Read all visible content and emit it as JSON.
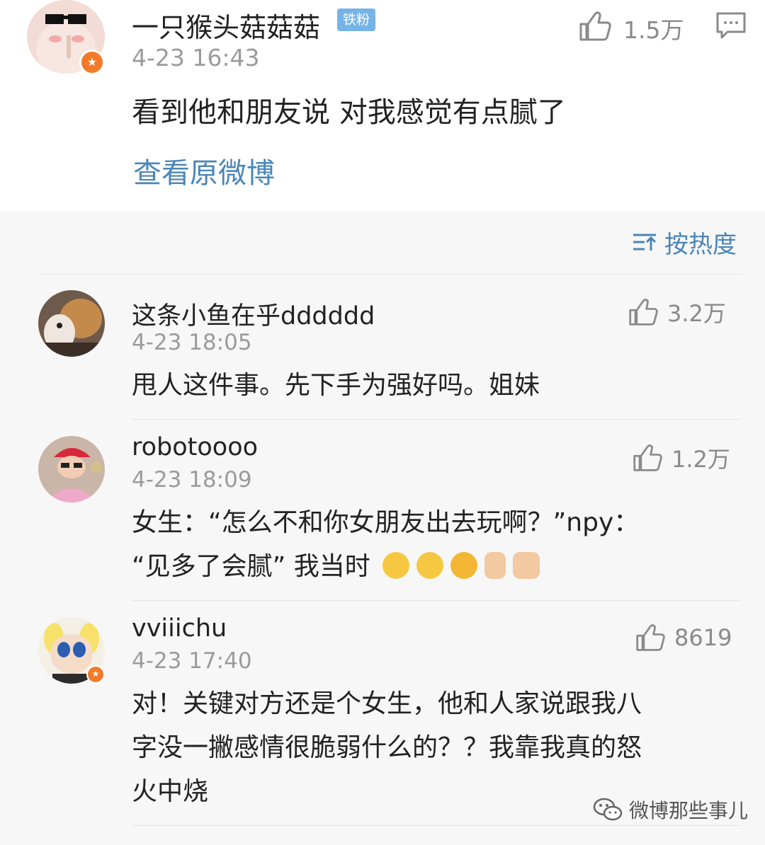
{
  "post": {
    "username": "一只猴头菇菇菇",
    "fan_badge": "铁粉",
    "time": "4-23 16:43",
    "likes": "1.5万",
    "text": "看到他和朋友说 对我感觉有点腻了",
    "view_original": "查看原微博",
    "avatar_icon": "avatar-sunglasses-cat",
    "verified_icon": "star-badge-icon"
  },
  "sort": {
    "label": "按热度",
    "icon": "sort-lines-icon"
  },
  "comments": [
    {
      "username": "这条小鱼在乎dddddd",
      "time": "4-23 18:05",
      "likes": "3.2万",
      "text": "甩人这件事。先下手为强好吗。姐妹",
      "avatar_icon": "avatar-dog"
    },
    {
      "username": "robotoooo",
      "time": "4-23 18:09",
      "likes": "1.2万",
      "text_line1": "女生：“怎么不和你女朋友出去玩啊？”npy：",
      "text_line2": "“见多了会腻” 我当时",
      "avatar_icon": "avatar-kid-red-hat",
      "emojis": [
        "smile-emoji",
        "smile-emoji",
        "grin-emoji",
        "thumbs-up-emoji",
        "ok-hand-emoji"
      ]
    },
    {
      "username": "vviiichu",
      "time": "4-23 17:40",
      "likes": "8619",
      "text_line1": "对！关键对方还是个女生，他和人家说跟我八",
      "text_line2": "字没一撇感情很脆弱什么的？？我靠我真的怒",
      "text_line3": "火中烧",
      "avatar_icon": "avatar-powerpuff-girl"
    }
  ],
  "watermark": {
    "text": "微博那些事儿",
    "icon": "wechat-icon"
  },
  "colors": {
    "link": "#4a86b8",
    "badge_orange": "#f27b2a",
    "fan_badge": "#76b3e7",
    "meta_gray": "#9b9b9b"
  }
}
